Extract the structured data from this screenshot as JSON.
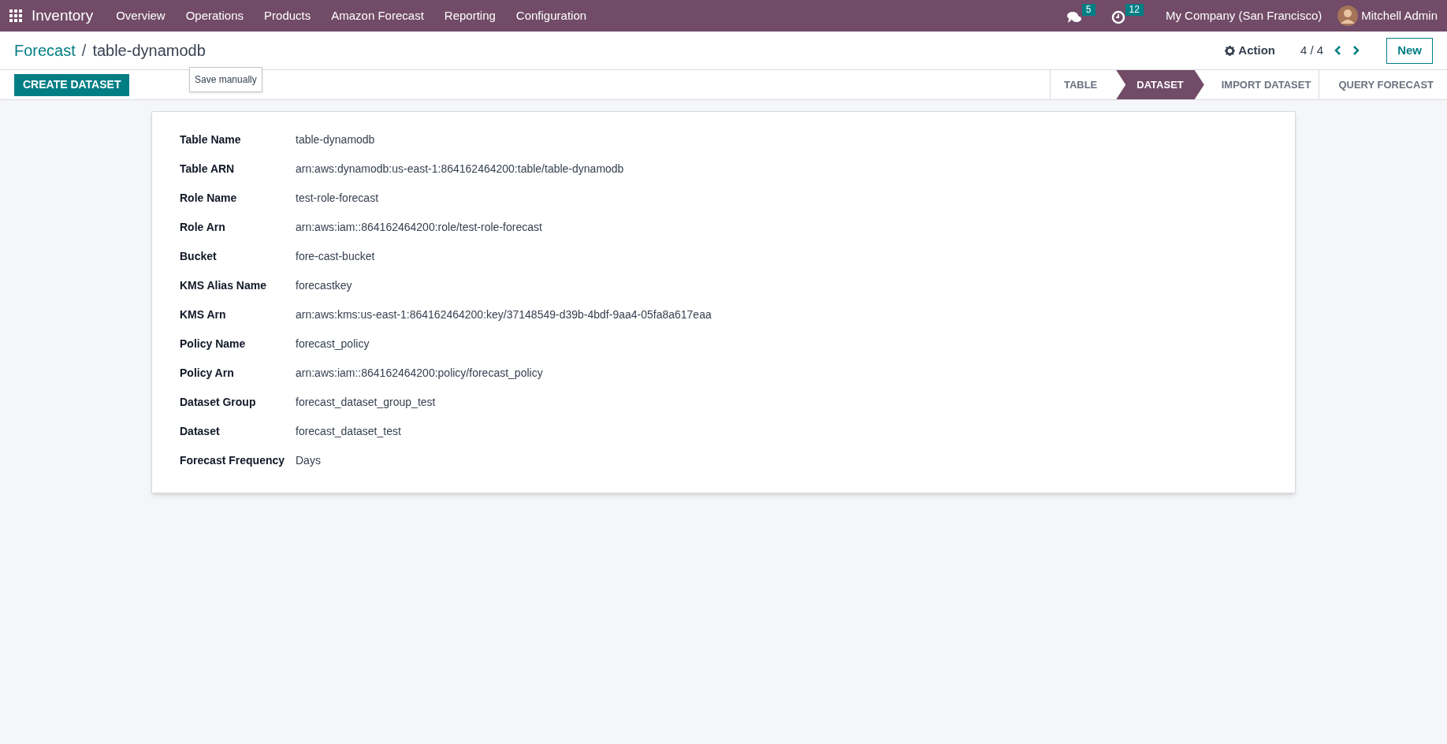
{
  "navbar": {
    "app_name": "Inventory",
    "menu": [
      "Overview",
      "Operations",
      "Products",
      "Amazon Forecast",
      "Reporting",
      "Configuration"
    ],
    "messages_count": "5",
    "activities_count": "12",
    "company": "My Company (San Francisco)",
    "user": "Mitchell Admin"
  },
  "breadcrumb": {
    "parent": "Forecast",
    "separator": "/",
    "current": "table-dynamodb"
  },
  "tooltip": "Save manually",
  "action_label": "Action",
  "pager": "4 / 4",
  "new_button": "New",
  "create_button": "CREATE DATASET",
  "stages": [
    {
      "label": "TABLE",
      "selected": false
    },
    {
      "label": "DATASET",
      "selected": true
    },
    {
      "label": "IMPORT DATASET",
      "selected": false
    },
    {
      "label": "QUERY FORECAST",
      "selected": false
    }
  ],
  "fields": [
    {
      "label": "Table Name",
      "value": "table-dynamodb"
    },
    {
      "label": "Table ARN",
      "value": "arn:aws:dynamodb:us-east-1:864162464200:table/table-dynamodb"
    },
    {
      "label": "Role Name",
      "value": "test-role-forecast"
    },
    {
      "label": "Role Arn",
      "value": "arn:aws:iam::864162464200:role/test-role-forecast"
    },
    {
      "label": "Bucket",
      "value": "fore-cast-bucket"
    },
    {
      "label": "KMS Alias Name",
      "value": "forecastkey"
    },
    {
      "label": "KMS Arn",
      "value": "arn:aws:kms:us-east-1:864162464200:key/37148549-d39b-4bdf-9aa4-05fa8a617eaa"
    },
    {
      "label": "Policy Name",
      "value": "forecast_policy"
    },
    {
      "label": "Policy Arn",
      "value": "arn:aws:iam::864162464200:policy/forecast_policy"
    },
    {
      "label": "Dataset Group",
      "value": "forecast_dataset_group_test"
    },
    {
      "label": "Dataset",
      "value": "forecast_dataset_test"
    },
    {
      "label": "Forecast Frequency",
      "value": "Days"
    }
  ]
}
